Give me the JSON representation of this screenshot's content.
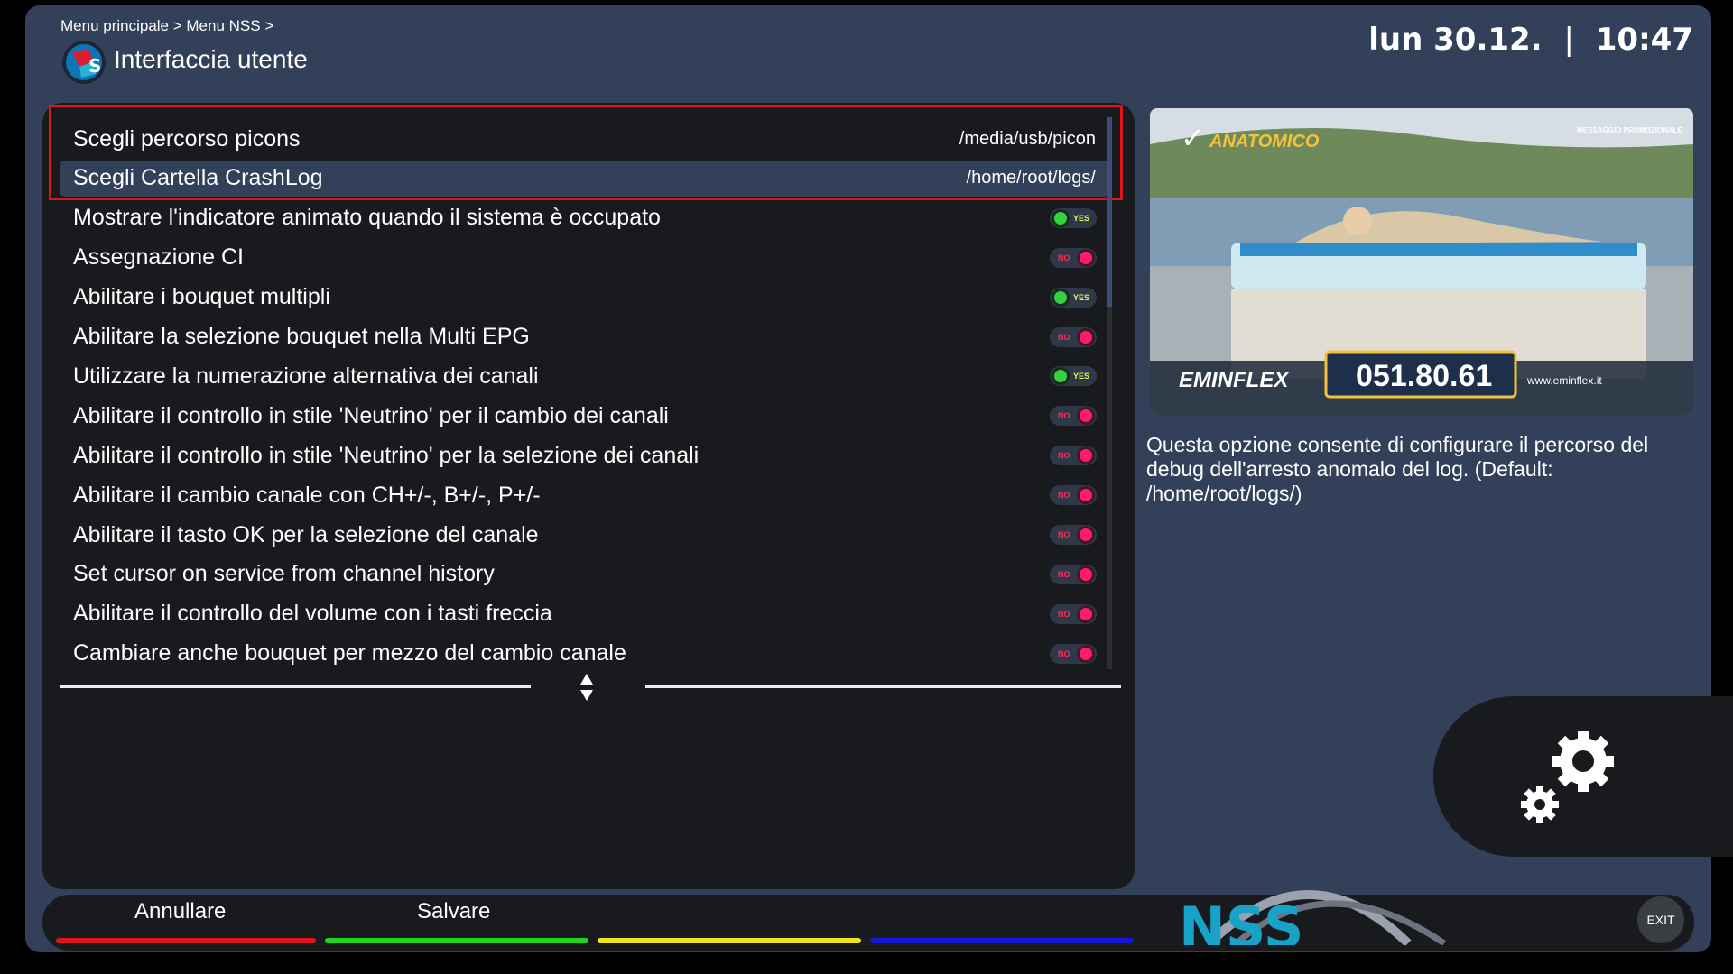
{
  "header": {
    "breadcrumb": "Menu principale > Menu NSS >",
    "title": "Interfaccia utente",
    "date": "lun 30.12.",
    "separator": "|",
    "time": "10:47"
  },
  "menu": {
    "items": [
      {
        "label": "Scegli percorso picons",
        "value": "/media/usb/picon",
        "type": "path"
      },
      {
        "label": "Scegli Cartella CrashLog",
        "value": "/home/root/logs/",
        "type": "path",
        "selected": true
      },
      {
        "label": "Mostrare l'indicatore animato quando il sistema è occupato",
        "value": "YES",
        "type": "toggle"
      },
      {
        "label": "Assegnazione CI",
        "value": "NO",
        "type": "toggle"
      },
      {
        "label": "Abilitare i bouquet multipli",
        "value": "YES",
        "type": "toggle"
      },
      {
        "label": "Abilitare la selezione bouquet nella Multi EPG",
        "value": "NO",
        "type": "toggle"
      },
      {
        "label": "Utilizzare la numerazione alternativa dei canali",
        "value": "YES",
        "type": "toggle"
      },
      {
        "label": "Abilitare il controllo in stile 'Neutrino' per il cambio dei canali",
        "value": "NO",
        "type": "toggle"
      },
      {
        "label": "Abilitare il controllo in stile 'Neutrino' per la selezione dei canali",
        "value": "NO",
        "type": "toggle"
      },
      {
        "label": "Abilitare il cambio canale con CH+/-, B+/-, P+/-",
        "value": "NO",
        "type": "toggle"
      },
      {
        "label": "Abilitare il tasto OK per la selezione del canale",
        "value": "NO",
        "type": "toggle"
      },
      {
        "label": "Set cursor on service from channel history",
        "value": "NO",
        "type": "toggle"
      },
      {
        "label": "Abilitare il controllo del volume con i tasti freccia",
        "value": "NO",
        "type": "toggle"
      },
      {
        "label": "Cambiare anche bouquet per mezzo del cambio canale",
        "value": "NO",
        "type": "toggle"
      }
    ]
  },
  "preview": {
    "badge": "ANATOMICO",
    "promo": "MESSAGGIO PROMOZIONALE",
    "brand": "EMINFLEX",
    "phone": "051.80.61",
    "website": "www.eminflex.it"
  },
  "description": "Questa opzione consente di configurare il percorso del debug dell'arresto anomalo del log.  (Default: /home/root/logs/)",
  "footer": {
    "red_label": "Annullare",
    "green_label": "Salvare",
    "exit_label": "EXIT",
    "logo_text": "NSS",
    "colors": {
      "red": "#e0141b",
      "green": "#1ed61e",
      "yellow": "#f2e51a",
      "blue": "#1418d6"
    }
  },
  "icons": {
    "gear": "gear-icon",
    "updown": "updown-arrows-icon",
    "logo": "nss-logo-icon"
  }
}
